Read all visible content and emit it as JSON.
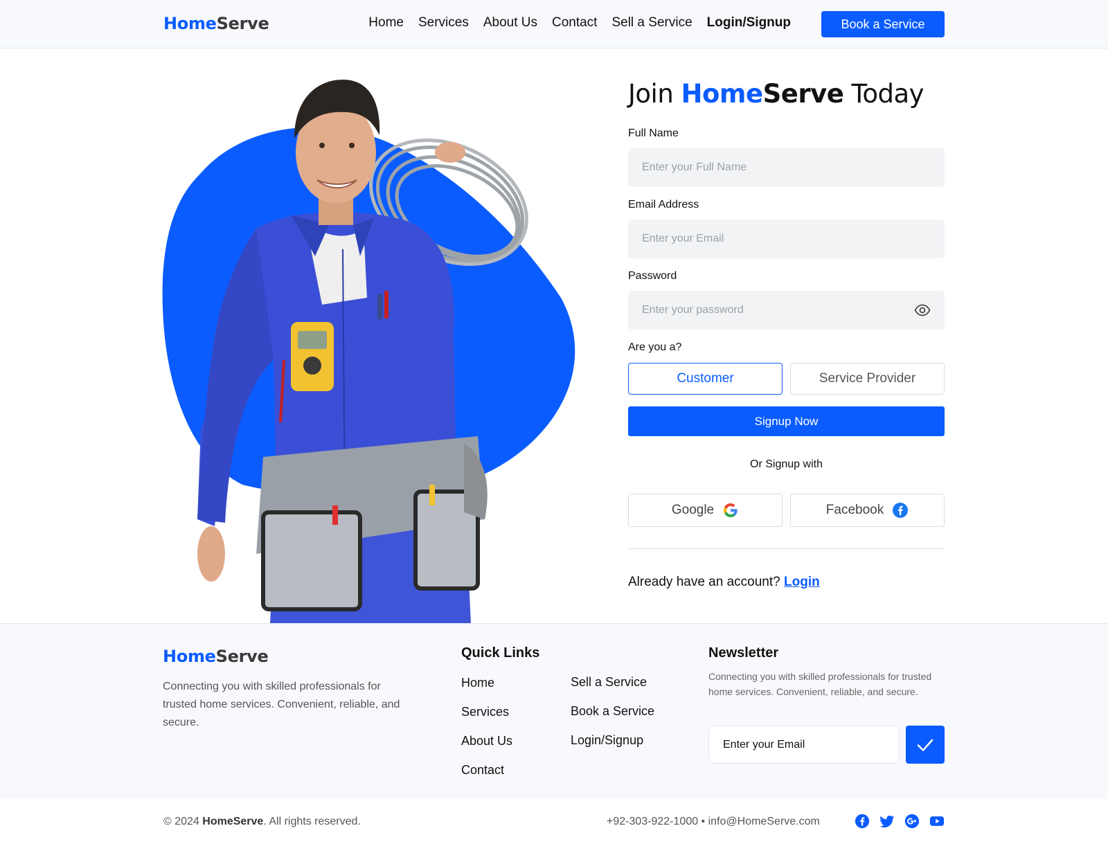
{
  "brand": {
    "part1": "Home",
    "part2": "Serve"
  },
  "nav": {
    "items": [
      "Home",
      "Services",
      "About Us",
      "Contact",
      "Sell a Service"
    ],
    "login": "Login/Signup",
    "cta": "Book a Service"
  },
  "form": {
    "title_prefix": "Join ",
    "title_brand1": "Home",
    "title_brand2": "Serve",
    "title_suffix": " Today",
    "full_name": {
      "label": "Full Name",
      "placeholder": "Enter your Full Name"
    },
    "email": {
      "label": "Email Address",
      "placeholder": "Enter your Email"
    },
    "password": {
      "label": "Password",
      "placeholder": "Enter your password"
    },
    "role_question": "Are you a?",
    "roles": [
      "Customer",
      "Service Provider"
    ],
    "selected_role": "Customer",
    "submit": "Signup Now",
    "or_text": "Or Signup with",
    "social": [
      "Google",
      "Facebook"
    ],
    "already_text": "Already have an account?",
    "login_link": "Login"
  },
  "footer": {
    "description": "Connecting you with skilled professionals for trusted home services. Convenient, reliable, and secure.",
    "quick_links_title": "Quick Links",
    "links_col1": [
      "Home",
      "Services",
      "About Us",
      "Contact"
    ],
    "links_col2": [
      "Sell a Service",
      "Book a Service",
      "Login/Signup"
    ],
    "newsletter_title": "Newsletter",
    "newsletter_desc": "Connecting you with skilled professionals for trusted home services. Convenient, reliable, and secure.",
    "newsletter_placeholder": "Enter your Email"
  },
  "bottom": {
    "copy_prefix": "© 2024 ",
    "copy_brand": "HomeServe",
    "copy_suffix": ". All rights reserved.",
    "contact": "+92-303-922-1000 • info@HomeServe.com",
    "social_icons": [
      "facebook-icon",
      "twitter-icon",
      "google-plus-icon",
      "youtube-icon"
    ]
  },
  "colors": {
    "accent": "#0b5cff",
    "page_bg": "#ffffff",
    "footer_bg": "#f7f9fc",
    "input_bg": "#f2f3f5"
  }
}
